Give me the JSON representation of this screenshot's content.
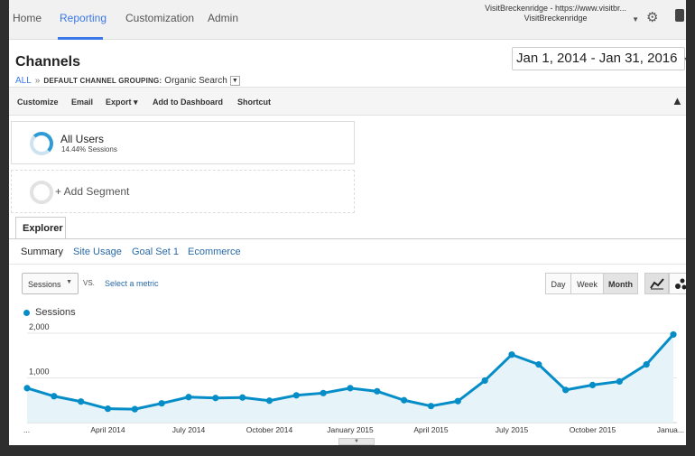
{
  "nav": {
    "tabs": [
      {
        "label": "Home"
      },
      {
        "label": "Reporting"
      },
      {
        "label": "Customization"
      },
      {
        "label": "Admin"
      }
    ],
    "active_tab": "Reporting",
    "account_line1": "VisitBreckenridge - https://www.visitbr...",
    "account_line2": "VisitBreckenridge"
  },
  "header": {
    "title": "Channels",
    "breadcrumb_root": "ALL",
    "breadcrumb_sep": "»",
    "grouping_key": "DEFAULT CHANNEL GROUPING:",
    "grouping_value": "Organic Search",
    "date_range": "Jan 1, 2014 - Jan 31, 2016"
  },
  "actions": {
    "customize": "Customize",
    "email": "Email",
    "export": "Export ▾",
    "add_to_dashboard": "Add to Dashboard",
    "shortcut": "Shortcut"
  },
  "segments": {
    "all_users_name": "All Users",
    "all_users_sub": "14.44% Sessions",
    "add_segment": "+ Add Segment"
  },
  "explorer": {
    "tab_label": "Explorer",
    "subtabs": [
      {
        "label": "Summary"
      },
      {
        "label": "Site Usage"
      },
      {
        "label": "Goal Set 1"
      },
      {
        "label": "Ecommerce"
      }
    ],
    "active_subtab": "Summary"
  },
  "controls": {
    "metric": "Sessions",
    "vs": "VS.",
    "select_metric": "Select a metric",
    "granularity": [
      "Day",
      "Week",
      "Month"
    ],
    "active_granularity": "Month"
  },
  "colors": {
    "accent": "#3b78e7",
    "series": "#058dc7",
    "fill": "#e6f3f9"
  },
  "chart_data": {
    "type": "area",
    "series": [
      {
        "name": "Sessions",
        "values": [
          770,
          590,
          470,
          310,
          300,
          430,
          570,
          550,
          560,
          490,
          610,
          660,
          770,
          700,
          500,
          370,
          480,
          940,
          1520,
          1300,
          730,
          840,
          920,
          1300,
          1970
        ]
      }
    ],
    "x": [
      "Jan 2014",
      "Feb 2014",
      "Mar 2014",
      "Apr 2014",
      "May 2014",
      "Jun 2014",
      "Jul 2014",
      "Aug 2014",
      "Sep 2014",
      "Oct 2014",
      "Nov 2014",
      "Dec 2014",
      "Jan 2015",
      "Feb 2015",
      "Mar 2015",
      "Apr 2015",
      "May 2015",
      "Jun 2015",
      "Jul 2015",
      "Aug 2015",
      "Sep 2015",
      "Oct 2015",
      "Nov 2015",
      "Dec 2015",
      "Jan 2016"
    ],
    "x_tick_labels": [
      "...",
      "April 2014",
      "July 2014",
      "October 2014",
      "January 2015",
      "April 2015",
      "July 2015",
      "October 2015",
      "Janua..."
    ],
    "x_tick_index": [
      0,
      3,
      6,
      9,
      12,
      15,
      18,
      21,
      24
    ],
    "y_tick_labels": [
      "2,000",
      "1,000"
    ],
    "y_tick_values": [
      2000,
      1000
    ],
    "ylim": [
      0,
      2100
    ],
    "grid": true,
    "legend": "top-left"
  }
}
